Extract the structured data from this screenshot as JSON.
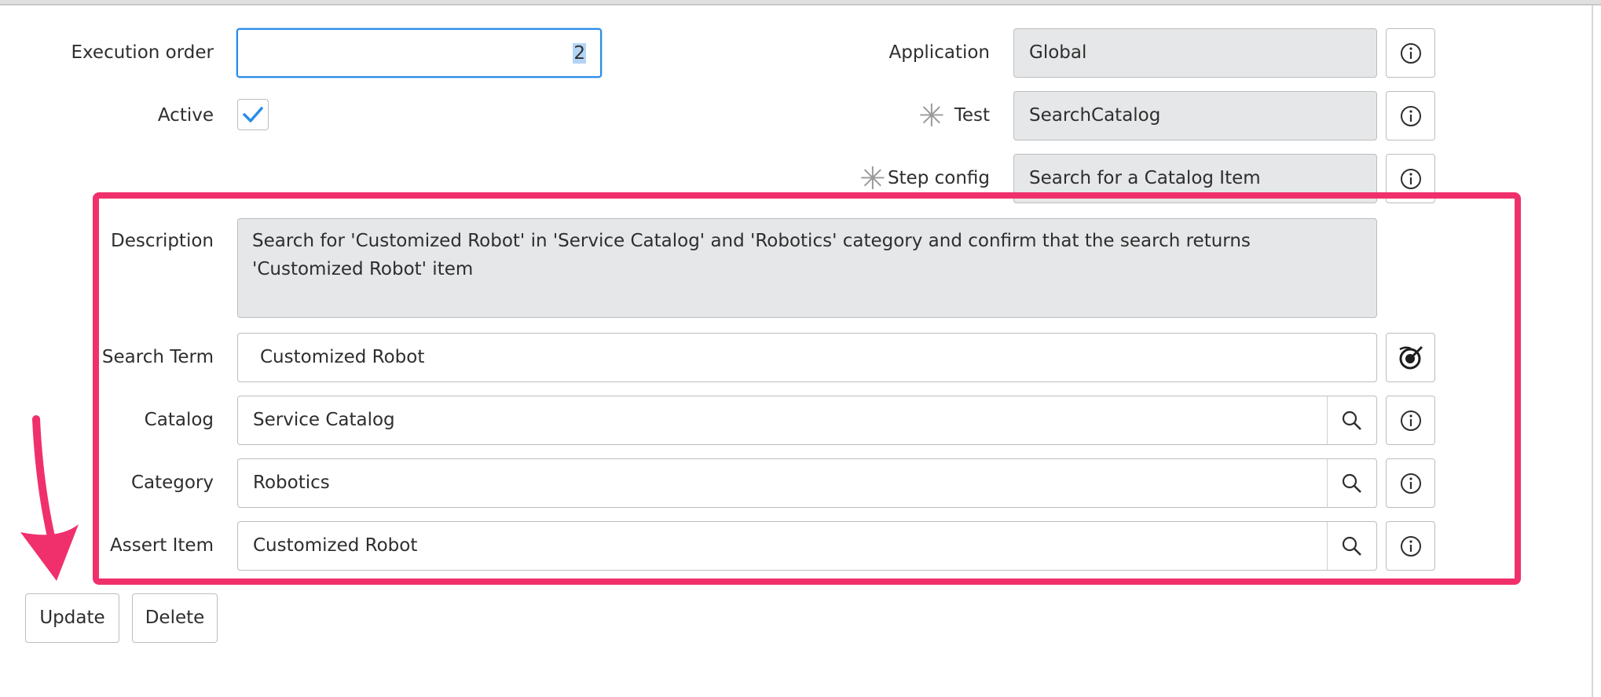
{
  "form": {
    "execution_order": {
      "label": "Execution order",
      "value": "2"
    },
    "active": {
      "label": "Active",
      "checked": true
    },
    "application": {
      "label": "Application",
      "value": "Global"
    },
    "test": {
      "label": "Test",
      "value": "SearchCatalog",
      "required_mark": "✳"
    },
    "step_config": {
      "label": "Step config",
      "value": "Search for a Catalog Item",
      "required_mark": "✳"
    },
    "description": {
      "label": "Description",
      "value": "Search for 'Customized Robot' in 'Service Catalog' and 'Robotics' category and confirm that the search returns 'Customized Robot' item"
    },
    "search_term": {
      "label": "Search Term",
      "value": "Customized Robot"
    },
    "catalog": {
      "label": "Catalog",
      "value": "Service Catalog"
    },
    "category": {
      "label": "Category",
      "value": "Robotics"
    },
    "assert_item": {
      "label": "Assert Item",
      "value": "Customized Robot"
    }
  },
  "buttons": {
    "update": "Update",
    "delete": "Delete"
  },
  "icons": {
    "info": "info-icon",
    "search": "magnifier-icon",
    "data_pill": "data-pill-picker-icon",
    "check": "checkmark-icon"
  },
  "colors": {
    "highlight": "#f0306c",
    "focus": "#2a8de8",
    "readonly_bg": "#e6e7e8",
    "check": "#2a8de8"
  }
}
